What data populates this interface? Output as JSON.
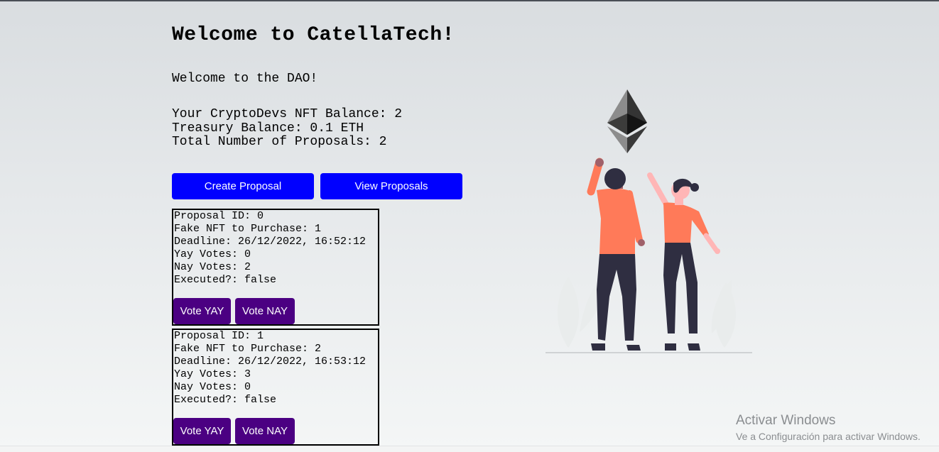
{
  "header": {
    "title": "Welcome to CatellaTech!"
  },
  "main": {
    "welcome": "Welcome to the DAO!",
    "nft_balance": "Your CryptoDevs NFT Balance: 2",
    "treasury_balance": "Treasury Balance: 0.1 ETH",
    "total_proposals": "Total Number of Proposals: 2",
    "create_button": "Create Proposal",
    "view_button": "View Proposals"
  },
  "proposals": [
    {
      "id": "Proposal ID: 0",
      "nft": "Fake NFT to Purchase: 1",
      "deadline": "Deadline: 26/12/2022, 16:52:12",
      "yay": "Yay Votes: 0",
      "nay": "Nay Votes: 2",
      "executed": "Executed?: false",
      "vote_yay_label": "Vote YAY",
      "vote_nay_label": "Vote NAY"
    },
    {
      "id": "Proposal ID: 1",
      "nft": "Fake NFT to Purchase: 2",
      "deadline": "Deadline: 26/12/2022, 16:53:12",
      "yay": "Yay Votes: 3",
      "nay": "Nay Votes: 0",
      "executed": "Executed?: false",
      "vote_yay_label": "Vote YAY",
      "vote_nay_label": "Vote NAY"
    }
  ],
  "watermark": {
    "title": "Activar Windows",
    "subtitle": "Ve a Configuración para activar Windows."
  },
  "colors": {
    "primary_button": "#0000ff",
    "vote_button": "#4b0082",
    "figure_shirt": "#ff7a59",
    "figure_pants": "#2f2e41"
  },
  "icons": {
    "ethereum_logo": "ethereum-logo-icon",
    "illustration": "celebrating-people-illustration"
  }
}
